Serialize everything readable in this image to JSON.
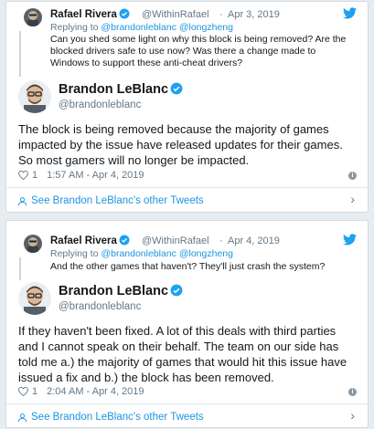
{
  "tweet1": {
    "quote": {
      "name": "Rafael Rivera",
      "handle": "@WithinRafael",
      "sep": "·",
      "date": "Apr 3, 2019",
      "replying_prefix": "Replying to ",
      "replying_to": "@brandonleblanc @longzheng",
      "text": "Can you shed some light on why this block is being removed? Are the blocked drivers safe to use now? Was there a change made to Windows to support these anti-cheat drivers?"
    },
    "author": {
      "name": "Brandon LeBlanc",
      "handle": "@brandonleblanc"
    },
    "body": "The block is being removed because the majority of games impacted by the issue have released updates for their games. So most gamers will no longer be impacted.",
    "likes": "1",
    "timestamp": "1:57 AM - Apr 4, 2019",
    "more_link": "See Brandon LeBlanc's other Tweets"
  },
  "tweet2": {
    "quote": {
      "name": "Rafael Rivera",
      "handle": "@WithinRafael",
      "sep": "·",
      "date": "Apr 4, 2019",
      "replying_prefix": "Replying to ",
      "replying_to": "@brandonleblanc @longzheng",
      "text": "And the other games that haven't? They'll just crash the system?"
    },
    "author": {
      "name": "Brandon LeBlanc",
      "handle": "@brandonleblanc"
    },
    "body": "If they haven't been fixed. A lot of this deals with third parties and I cannot speak on their behalf. The team on our side has told me a.) the majority of games that would hit this issue have issued a fix and b.) the block has been removed.",
    "likes": "1",
    "timestamp": "2:04 AM - Apr 4, 2019",
    "more_link": "See Brandon LeBlanc's other Tweets"
  },
  "colors": {
    "brand": "#1da1f2",
    "link": "#1b95e0",
    "verified": "#1da1f2",
    "muted": "#657786"
  },
  "icons": [
    "twitter-bird-icon",
    "verified-badge-icon",
    "heart-icon",
    "info-icon",
    "user-icon",
    "chevron-right-icon"
  ]
}
